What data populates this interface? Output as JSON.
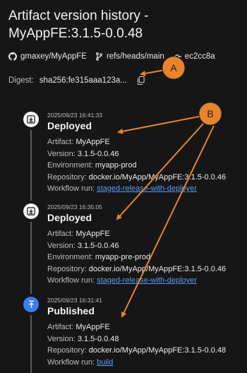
{
  "header": {
    "title": "Artifact version history - MyAppFE:3.1.5-0.0.48"
  },
  "meta": {
    "repo": "gmaxey/MyAppFE",
    "ref": "refs/heads/main",
    "commit": "ec2cc8a"
  },
  "digest": {
    "label": "Digest:",
    "value": "sha256:fe315aaa123a..."
  },
  "labels": {
    "artifact": "Artifact:",
    "version": "Version:",
    "environment": "Environment:",
    "repository": "Repository:",
    "workflow_run": "Workflow run:"
  },
  "timeline": [
    {
      "timestamp": "2025/09/23 16:41:33",
      "event": "Deployed",
      "icon": "deploy-icon",
      "artifact": "MyAppFE",
      "version": "3.1.5-0.0.46",
      "environment": "myapp-prod",
      "repository": "docker.io/MyApp/MyAppFE:3.1.5-0.0.46",
      "workflow_run": "staged-release-with-deployer"
    },
    {
      "timestamp": "2025/09/23 16:35:05",
      "event": "Deployed",
      "icon": "deploy-icon",
      "artifact": "MyAppFE",
      "version": "3.1.5-0.0.46",
      "environment": "myapp-pre-prod",
      "repository": "docker.io/MyApp/MyAppFE:3.1.5-0.0.46",
      "workflow_run": "staged-release-with-deployer"
    },
    {
      "timestamp": "2025/09/23 16:31:41",
      "event": "Published",
      "icon": "publish-icon",
      "artifact": "MyAppFE",
      "version": "3.1.5-0.0.48",
      "repository": "docker.io/MyApp/MyAppFE:3.1.5-0.0.48",
      "workflow_run": "build"
    }
  ],
  "annotations": {
    "a": "A",
    "b": "B",
    "color": "#e8842c"
  },
  "colors": {
    "background": "#161616",
    "link": "#5b9cf2",
    "publish_node": "#3b7ef0"
  }
}
